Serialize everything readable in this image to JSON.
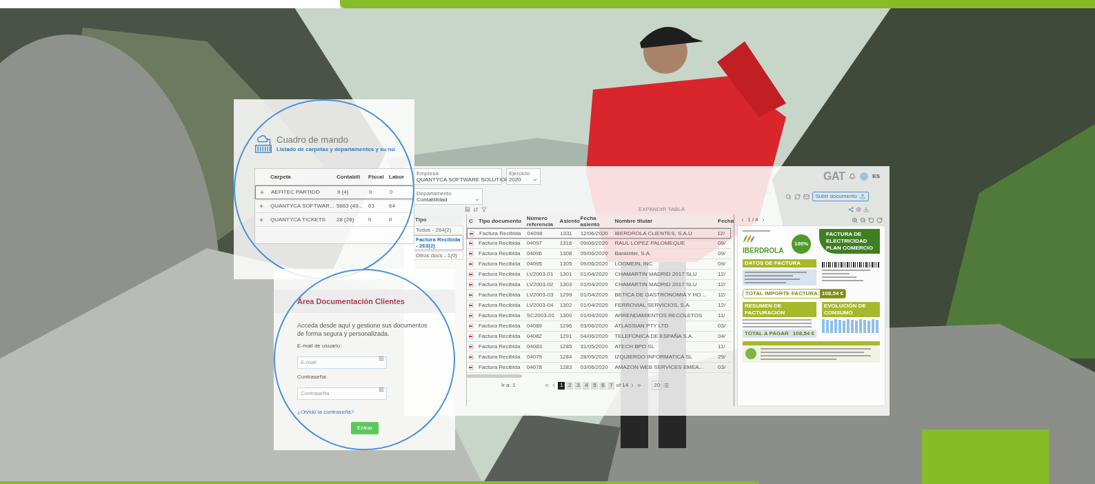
{
  "dashboard_card": {
    "title": "Cuadro de mando",
    "subtitle": "Listado de carpetas y departamentos y su nú",
    "columns": [
      "Carpeta",
      "Contabili",
      "Fiscal",
      "Labor"
    ],
    "rows": [
      {
        "cells": [
          "AEFITEC PARTIDO",
          "9 (4)",
          "0",
          "0"
        ],
        "selected": true
      },
      {
        "cells": [
          "QUANTYCA SOFTWAR...",
          "5863 (49...",
          "63",
          "64"
        ],
        "selected": false
      },
      {
        "cells": [
          "QUANTYCA TICKETS",
          "28 (28)",
          "0",
          "0"
        ],
        "selected": false
      }
    ]
  },
  "login_card": {
    "title": "Área Documentación Clientes",
    "intro": "Acceda desde aquí y gestione sus documentos de forma segura y personalizada.",
    "fields": [
      {
        "label": "E-mail de usuario:",
        "placeholder": "E-mail"
      },
      {
        "label": "Contraseña:",
        "placeholder": "Contraseña"
      }
    ],
    "link": "¿Olvidó la contraseña?",
    "button": "Entrar"
  },
  "app": {
    "filters": [
      {
        "label": "Empresa",
        "value": "QUANTYCA SOFTWARE SOLUTIOI"
      },
      {
        "label": "Ejercicio",
        "value": "2020"
      }
    ],
    "department": {
      "label": "Departamento",
      "value": "Contabilidad"
    },
    "logo": "GAT",
    "language": "ES",
    "upload_button": "Subir documento",
    "expand": "EXPANDIR TABLA",
    "type_filter": {
      "title": "Tipo",
      "items": [
        {
          "label": "Todos - 264(2)",
          "selected": false
        },
        {
          "label": "Factura Recibida - 263(2)",
          "selected": true
        },
        {
          "label": "Otros docs - 1(0)",
          "selected": false
        }
      ]
    },
    "table": {
      "icon_column": "C",
      "columns": [
        "Tipo documento",
        "Número referencia",
        "Asiento",
        "Fecha asiento",
        "Nombre titular",
        "Fecha"
      ],
      "rows": [
        {
          "cells": [
            "Factura Recibida",
            "04098",
            "1331",
            "12/06/2020",
            "IBERDROLA CLIENTES, S.A.U",
            "12/"
          ],
          "selected": true
        },
        {
          "cells": [
            "Factura Recibida",
            "04097",
            "1316",
            "09/06/2020",
            "RAUL LOPEZ PALOMEQUE",
            "09/"
          ],
          "selected": false
        },
        {
          "cells": [
            "Factura Recibida",
            "04096",
            "1308",
            "09/06/2020",
            "Bankinter, S.A.",
            "09/"
          ],
          "selected": false
        },
        {
          "cells": [
            "Factura Recibida",
            "04095",
            "1305",
            "09/06/2020",
            "LOGMEIN, INC",
            "09/"
          ],
          "selected": false
        },
        {
          "cells": [
            "Factura Recibida",
            "LV2003-01",
            "1301",
            "01/04/2020",
            "CHAMARTIN MADRID 2017 SLU",
            "12/"
          ],
          "selected": false
        },
        {
          "cells": [
            "Factura Recibida",
            "LV2003-02",
            "1303",
            "01/04/2020",
            "CHAMARTIN MADRID 2017 SLU",
            "12/"
          ],
          "selected": false
        },
        {
          "cells": [
            "Factura Recibida",
            "LV2003-03",
            "1299",
            "01/04/2020",
            "BETICA DE GASTRONOMIA Y HO...",
            "12/"
          ],
          "selected": false
        },
        {
          "cells": [
            "Factura Recibida",
            "LV2003-04",
            "1302",
            "01/04/2020",
            "FERROVIAL SERVICIOS, S.A.",
            "12/"
          ],
          "selected": false
        },
        {
          "cells": [
            "Factura Recibida",
            "SC2003-01",
            "1300",
            "01/04/2020",
            "ARRENDAMIENTOS RECOLETOS",
            "11/"
          ],
          "selected": false
        },
        {
          "cells": [
            "Factura Recibida",
            "04089",
            "1296",
            "03/06/2020",
            "ATLASSIAN PTY LTD",
            "03/"
          ],
          "selected": false
        },
        {
          "cells": [
            "Factura Recibida",
            "04082",
            "1291",
            "04/06/2020",
            "TELEFONICA DE ESPAÑA S.A.",
            "04/"
          ],
          "selected": false
        },
        {
          "cells": [
            "Factura Recibida",
            "04083",
            "1285",
            "31/05/2020",
            "ATECH BPO SL",
            "11/"
          ],
          "selected": false
        },
        {
          "cells": [
            "Factura Recibida",
            "04079",
            "1284",
            "28/05/2020",
            "IZQUIERDO INFORMATICA SL",
            "29/"
          ],
          "selected": false
        },
        {
          "cells": [
            "Factura Recibida",
            "04078",
            "1283",
            "03/06/2020",
            "AMAZON WEB SERVICES EMEA...",
            "03/"
          ],
          "selected": false
        }
      ]
    },
    "pagination": {
      "goto": "Ir a: 1",
      "pages": [
        {
          "label": "1",
          "selected": true
        },
        {
          "label": "2",
          "selected": false
        },
        {
          "label": "3",
          "selected": false
        },
        {
          "label": "4",
          "selected": false
        },
        {
          "label": "5",
          "selected": false
        },
        {
          "label": "6",
          "selected": false
        },
        {
          "label": "7",
          "selected": false
        }
      ],
      "total": "of 14",
      "page_size": "20"
    },
    "viewer": {
      "page": "1 / 4",
      "brand": "IBERDROLA",
      "heading": "FACTURA DE ELECTRICIDAD PLAN COMERCIO",
      "badge": "100%",
      "sections": [
        "DATOS DE FACTURA",
        "RESUMEN DE FACTURACIÓN",
        "EVOLUCIÓN DE CONSUMO"
      ],
      "total_label": "TOTAL IMPORTE FACTURA:",
      "total": "108,54 €",
      "pay_label": "TOTAL A PAGAR",
      "pay": "108,54 €"
    }
  }
}
